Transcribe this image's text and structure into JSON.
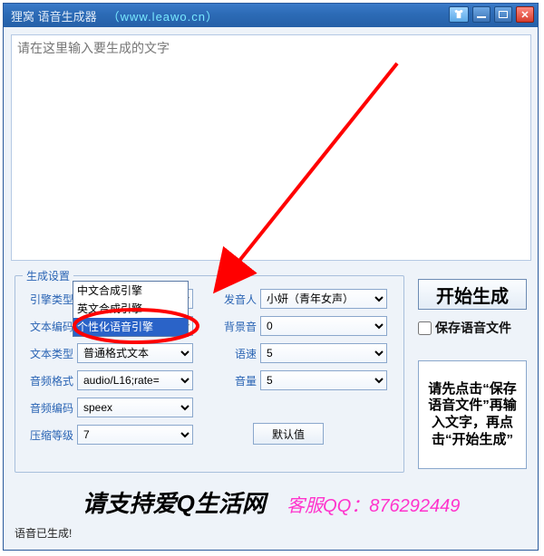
{
  "title": {
    "app": "狸窝  语音生成器",
    "url": "（www.leawo.cn）"
  },
  "textarea": {
    "placeholder": "请在这里输入要生成的文字"
  },
  "fieldset_legend": "生成设置",
  "labels": {
    "engine": "引擎类型",
    "textenc": "文本编码",
    "texttype": "文本类型",
    "audiofmt": "音频格式",
    "audioenc": "音频编码",
    "compress": "压缩等级",
    "speaker": "发音人",
    "bgm": "背景音",
    "speed": "语速",
    "volume": "音量"
  },
  "values": {
    "engine": "中文合成引擎",
    "texttype": "普通格式文本",
    "audiofmt": "audio/L16;rate=",
    "audioenc": "speex",
    "compress": "7",
    "speaker": "小妍（青年女声）",
    "bgm": "0",
    "speed": "5",
    "volume": "5"
  },
  "dropdown": {
    "items": [
      "中文合成引擎",
      "英文合成引擎",
      "个性化语音引擎"
    ],
    "selected_index": 2
  },
  "buttons": {
    "defaults": "默认值",
    "start": "开始生成",
    "save_check": "保存语音文件"
  },
  "hint": "请先点击“保存语音文件”再输入文字，再点击“开始生成”",
  "footer": {
    "support": "请支持爱Q生活网",
    "qq": "客服QQ：876292449"
  },
  "status": "语音已生成!"
}
